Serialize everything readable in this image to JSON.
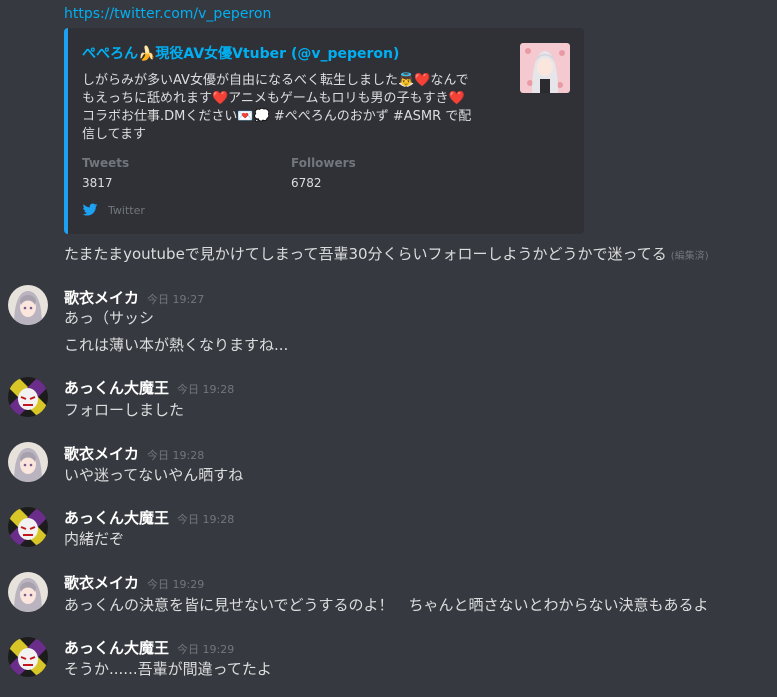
{
  "embed": {
    "link": "https://twitter.com/v_peperon",
    "author": "ぺぺろん🍌現役AV女優Vtuber (@v_peperon)",
    "description_lines": [
      "しがらみが多いAV女優が自由になるべく転生しました👼❤️なんで",
      "もえっちに舐めれます❤️アニメもゲームもロリも男の子もすき❤️",
      "コラボお仕事.DMください💌💭 #ぺぺろんのおかず #ASMR で配",
      "信してます"
    ],
    "fields": [
      {
        "name": "Tweets",
        "value": "3817"
      },
      {
        "name": "Followers",
        "value": "6782"
      }
    ],
    "footer": "Twitter"
  },
  "continuation": {
    "text": "たまたまyoutubeで見かけてしまって吾輩30分くらいフォローしようかどうかで迷ってる",
    "edited": "(編集済)"
  },
  "messages": [
    {
      "author": "歌衣メイカ",
      "timestamp": "今日 19:27",
      "lines": [
        "あっ（サッシ",
        "これは薄い本が熱くなりますね..."
      ]
    },
    {
      "author": "あっくん大魔王",
      "timestamp": "今日 19:28",
      "lines": [
        "フォローしました"
      ]
    },
    {
      "author": "歌衣メイカ",
      "timestamp": "今日 19:28",
      "lines": [
        "いや迷ってないやん晒すね"
      ]
    },
    {
      "author": "あっくん大魔王",
      "timestamp": "今日 19:28",
      "lines": [
        "内緒だぞ"
      ]
    },
    {
      "author": "歌衣メイカ",
      "timestamp": "今日 19:29",
      "lines": [
        "あっくんの決意を皆に見せないでどうするのよ！　ちゃんと晒さないとわからない決意もあるよ"
      ]
    },
    {
      "author": "あっくん大魔王",
      "timestamp": "今日 19:29",
      "lines": [
        "そうか......吾輩が間違ってたよ"
      ]
    }
  ],
  "colors": {
    "background": "#36393f",
    "embed_bg": "#2f3136",
    "twitter_blue": "#1da1f2",
    "link": "#00b0f4"
  }
}
